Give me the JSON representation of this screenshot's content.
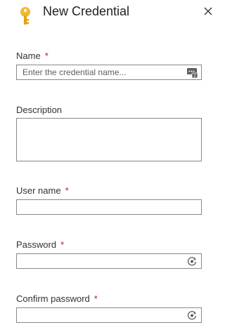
{
  "panel": {
    "title": "New Credential",
    "icon": "key-icon",
    "close_icon": "close-icon"
  },
  "form": {
    "required_marker": "*",
    "name": {
      "label": "Name",
      "placeholder": "Enter the credential name...",
      "value": "",
      "required": true,
      "icon": "key-vault-reference-icon"
    },
    "description": {
      "label": "Description",
      "value": "",
      "required": false
    },
    "user_name": {
      "label": "User name",
      "value": "",
      "required": true
    },
    "password": {
      "label": "Password",
      "value": "",
      "required": true,
      "icon": "reveal-password-icon"
    },
    "confirm_password": {
      "label": "Confirm password",
      "value": "",
      "required": true,
      "icon": "reveal-password-icon"
    }
  },
  "colors": {
    "required": "#a4262c",
    "key_gold": "#f2b82d",
    "border": "#8a8886",
    "text": "#323130"
  }
}
